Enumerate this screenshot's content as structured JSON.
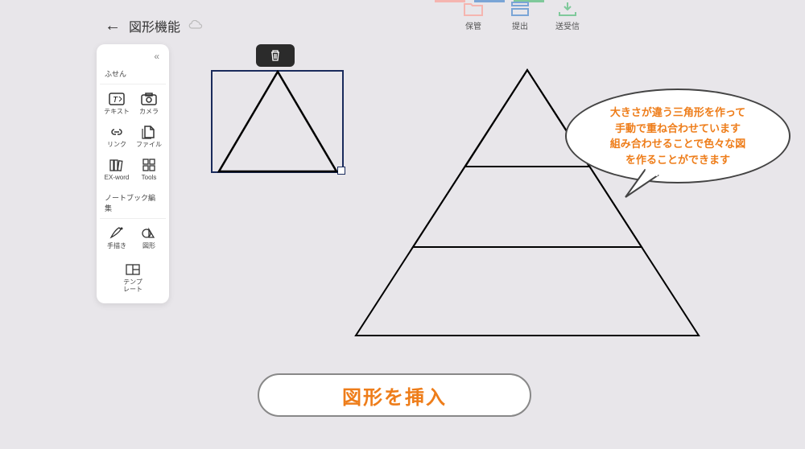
{
  "header": {
    "title": "図形機能"
  },
  "top_actions": {
    "save": "保管",
    "submit": "提出",
    "transfer": "送受信"
  },
  "toolbox": {
    "section_sticky": "ふせん",
    "section_notebook": "ノートブック編集",
    "text": "テキスト",
    "camera": "カメラ",
    "link": "リンク",
    "file": "ファイル",
    "exword": "EX-word",
    "tools": "Tools",
    "handdraw": "手描き",
    "shape": "図形",
    "template": "テンプ\nレート"
  },
  "bubble": {
    "line1": "大きさが違う三角形を作って",
    "line2": "手動で重ね合わせています",
    "line3": "組み合わせることで色々な図",
    "line4": "を作ることができます"
  },
  "insert_button": "図形を挿入"
}
